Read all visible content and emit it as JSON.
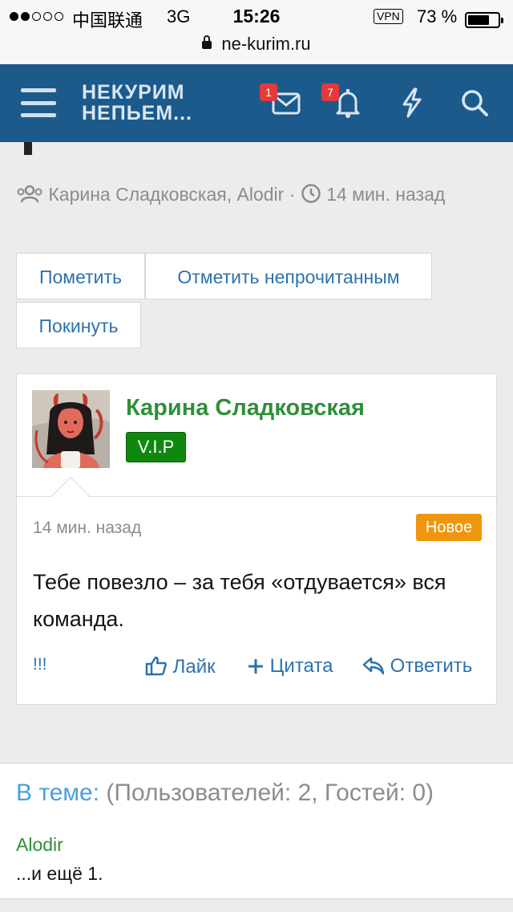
{
  "status_bar": {
    "carrier": "中国联通",
    "network": "3G",
    "time": "15:26",
    "vpn": "VPN",
    "battery": "73 %",
    "battery_level": 0.73,
    "url": "ne-kurim.ru"
  },
  "nav": {
    "logo_line1": "НЕКУРИМ",
    "logo_line2": "НЕПЬЕМ...",
    "inbox_badge": "1",
    "alerts_badge": "7",
    "icons": [
      "menu-icon",
      "envelope-icon",
      "bell-icon",
      "bolt-icon",
      "search-icon"
    ]
  },
  "thread": {
    "participants": "Карина Сладковская, Alodir",
    "separator": "·",
    "time_ago": "14 мин. назад"
  },
  "buttons": {
    "mark": "Пометить",
    "mark_unread": "Отметить непрочитанным",
    "leave": "Покинуть"
  },
  "post": {
    "author": "Карина Сладковская",
    "role_badge": "V.I.P",
    "time": "14 мин. назад",
    "new_label": "Новое",
    "text": "Тебе повезло – за тебя «отдувается» вся команда.",
    "report": "!!!",
    "like": "Лайк",
    "quote": "Цитата",
    "reply": "Ответить"
  },
  "online": {
    "label": "В теме:",
    "counts": "(Пользователей: 2, Гостей: 0)",
    "user": "Alodir",
    "more": "...и ещё 1."
  },
  "colors": {
    "nav_bg": "#1d5a8c",
    "link": "#2c72ad",
    "author": "#2f8f3b",
    "vip": "#108810",
    "new_badge": "#f0960e",
    "notif_badge": "#e53a3a"
  }
}
